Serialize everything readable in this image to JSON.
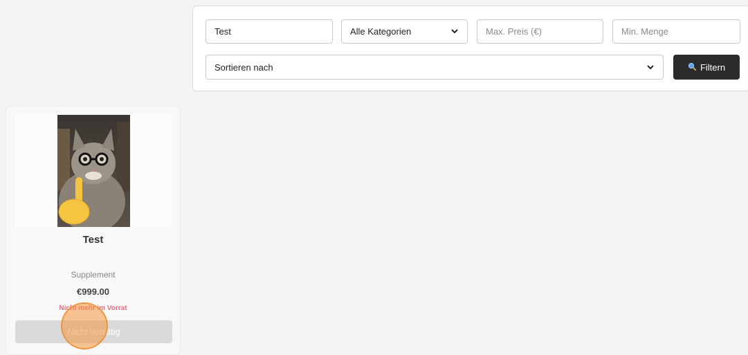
{
  "filters": {
    "search": {
      "value": "Test",
      "placeholder": ""
    },
    "category_select": {
      "selected": "Alle Kategorien"
    },
    "max_price": {
      "value": "",
      "placeholder": "Max. Preis (€)"
    },
    "min_quantity": {
      "value": "",
      "placeholder": "Min. Menge"
    },
    "sort_select": {
      "selected": "Sortieren nach"
    },
    "filter_button": {
      "label": "Filtern",
      "icon": "magnifier-icon"
    }
  },
  "products": [
    {
      "title": "Test",
      "image": "cat-with-glasses-photo",
      "category": "Supplement",
      "price": "€999.00",
      "stock_status": "Nicht mehr im Vorrat",
      "button_label": "Nicht vorrätig"
    }
  ],
  "colors": {
    "background": "#f4f4f4",
    "filter_button_bg": "#2b2b2b",
    "stock_status": "#e07080",
    "disabled_button": "#d9d9d9",
    "click_indicator": "#f6963c"
  }
}
